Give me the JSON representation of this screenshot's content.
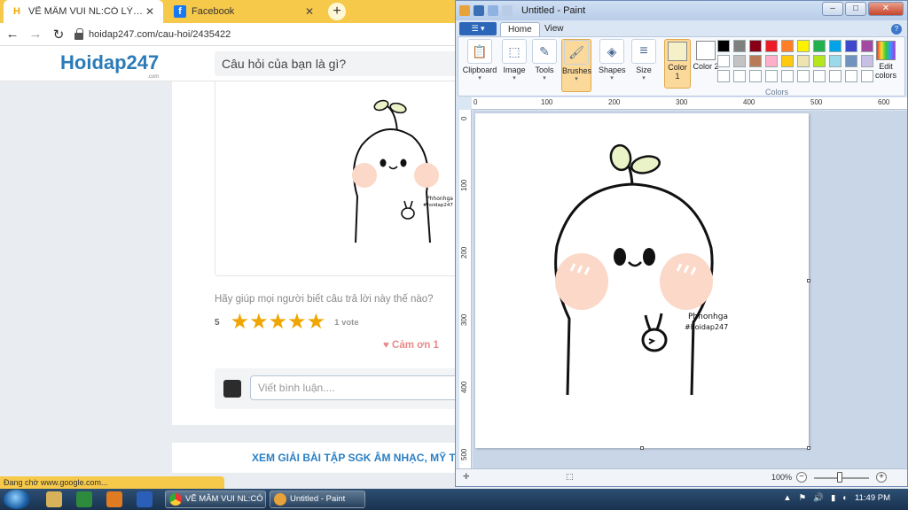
{
  "browser": {
    "tabs": [
      {
        "title": "VẼ MÂM VUI NL:CÓ LÝ DO CÁI ĐI",
        "favicon": "hoidap-favicon-icon",
        "active": true
      },
      {
        "title": "Facebook",
        "favicon": "facebook-icon",
        "active": false
      }
    ],
    "new_tab": "+",
    "url": "hoidap247.com/cau-hoi/2435422"
  },
  "site": {
    "logo": "Hoidap247",
    "logo_sub": ".com",
    "search_placeholder": "Câu hỏi của bạn là gì?",
    "help_text": "Hãy giúp mọi người biết câu trả lời này thế nào?",
    "rating_value": "5",
    "rating_stars": 5,
    "votes": "1 vote",
    "thanks": "♥ Cảm ơn 1",
    "comment_placeholder": "Viết bình luận....",
    "xem_link": "XEM GIẢI BÀI TẬP SGK ÂM NHẠC, MỸ THUẬT",
    "drawing_signature": "Phhonhga",
    "drawing_tag": "#hoidap247"
  },
  "status_text": "Đang chờ www.google.com...",
  "paint": {
    "title": "Untitled - Paint",
    "tabs": [
      "Home",
      "View"
    ],
    "groups": {
      "clipboard": "Clipboard",
      "image": "Image",
      "tools": "Tools",
      "brushes": "Brushes",
      "shapes": "Shapes",
      "size": "Size"
    },
    "color1": "Color 1",
    "color2": "Color 2",
    "colors_label": "Colors",
    "edit_colors": "Edit colors",
    "palette": [
      "#000000",
      "#7f7f7f",
      "#880015",
      "#ed1c24",
      "#ff7f27",
      "#fff200",
      "#22b14c",
      "#00a2e8",
      "#3f48cc",
      "#a349a4",
      "#ffffff",
      "#c3c3c3",
      "#b97a57",
      "#ffaec9",
      "#ffc90e",
      "#efe4b0",
      "#b5e61d",
      "#99d9ea",
      "#7092be",
      "#c8bfe7",
      "#ffffff",
      "#ffffff",
      "#ffffff",
      "#ffffff",
      "#ffffff",
      "#ffffff",
      "#ffffff",
      "#ffffff",
      "#ffffff",
      "#ffffff"
    ],
    "ruler_top": [
      "0",
      "100",
      "200",
      "300",
      "400",
      "500",
      "600"
    ],
    "ruler_left": [
      "0",
      "100",
      "200",
      "300",
      "400",
      "500"
    ],
    "zoom": "100%",
    "zoom_minus": "−",
    "zoom_plus": "+"
  },
  "taskbar": {
    "tasks": [
      {
        "label": "VẼ MÂM VUI NL:CÓ ...",
        "icon": "chrome-icon"
      },
      {
        "label": "Untitled - Paint",
        "icon": "paint-icon"
      }
    ],
    "clock": "11:49 PM"
  },
  "colors": {
    "accent_yellow": "#f6c94a",
    "link_blue": "#2b80c5",
    "star": "#f0a500"
  }
}
